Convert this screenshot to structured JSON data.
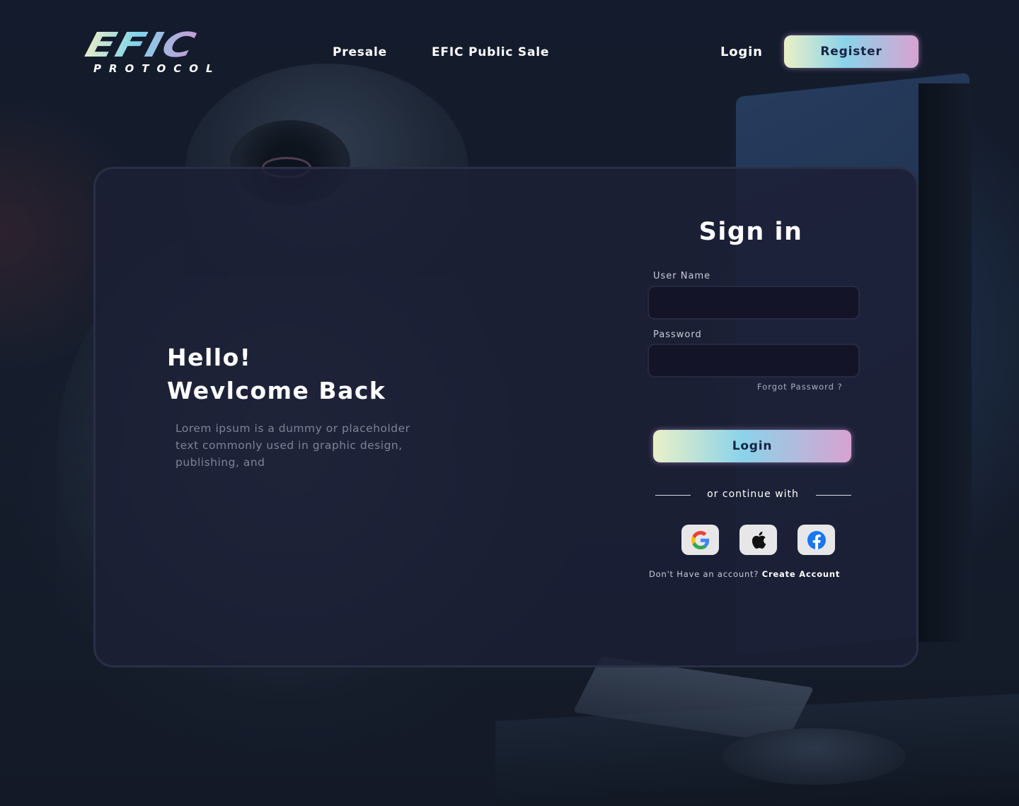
{
  "brand": {
    "logo_text": "EFIC",
    "logo_subtitle": "PROTOCOL"
  },
  "nav": {
    "presale": "Presale",
    "public_sale": "EFIC Public Sale",
    "login": "Login",
    "register": "Register"
  },
  "hero": {
    "greeting_line1": "Hello!",
    "greeting_line2": "Wevlcome Back",
    "description": "Lorem ipsum is a dummy or placeholder text commonly used in graphic design, publishing, and"
  },
  "form": {
    "title": "Sign in",
    "username_label": "User Name",
    "username_value": "",
    "password_label": "Password",
    "password_value": "",
    "forgot_password": "Forgot Password ?",
    "login_button": "Login",
    "divider_text": "or continue  with",
    "social": [
      {
        "icon": "google-icon"
      },
      {
        "icon": "apple-icon"
      },
      {
        "icon": "facebook-icon"
      }
    ],
    "no_account_text": "Don't Have an account?",
    "create_account": "Create Account"
  },
  "colors": {
    "button_gradient": [
      "#eaf0c7",
      "#8bd3ea",
      "#d8a2d0"
    ],
    "card_background": "#1c2036",
    "input_background": "#131427",
    "button_text": "#1a2245"
  }
}
